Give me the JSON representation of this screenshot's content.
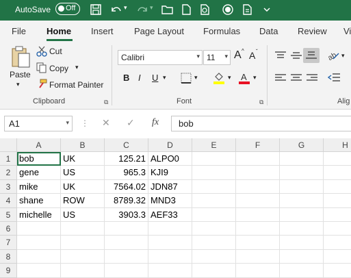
{
  "titlebar": {
    "autosave_label": "AutoSave",
    "toggle_state": "Off"
  },
  "tabs": [
    {
      "label": "File"
    },
    {
      "label": "Home"
    },
    {
      "label": "Insert"
    },
    {
      "label": "Page Layout"
    },
    {
      "label": "Formulas"
    },
    {
      "label": "Data"
    },
    {
      "label": "Review"
    },
    {
      "label": "Vi"
    }
  ],
  "ribbon": {
    "clipboard": {
      "paste": "Paste",
      "cut": "Cut",
      "copy": "Copy",
      "format_painter": "Format Painter",
      "group_label": "Clipboard"
    },
    "font": {
      "font_name": "Calibri",
      "font_size": "11",
      "grow": "A",
      "shrink": "A",
      "bold": "B",
      "italic": "I",
      "underline": "U",
      "group_label": "Font",
      "highlight_color": "#FFFF00",
      "font_color": "#E81123"
    },
    "alignment": {
      "group_label": "Alig"
    }
  },
  "formula_bar": {
    "name_box": "A1",
    "fx": "fx",
    "value": "bob"
  },
  "sheet": {
    "columns": [
      "A",
      "B",
      "C",
      "D",
      "E",
      "F",
      "G",
      "H"
    ],
    "rows": [
      "1",
      "2",
      "3",
      "4",
      "5",
      "6",
      "7",
      "8",
      "9"
    ],
    "data": [
      [
        "bob",
        "UK",
        "125.21",
        "ALPO0"
      ],
      [
        "gene",
        "US",
        "965.3",
        "KJI9"
      ],
      [
        "mike",
        "UK",
        "7564.02",
        "JDN87"
      ],
      [
        "shane",
        "ROW",
        "8789.32",
        "MND3"
      ],
      [
        "michelle",
        "US",
        "3903.3",
        "AEF33"
      ]
    ]
  }
}
